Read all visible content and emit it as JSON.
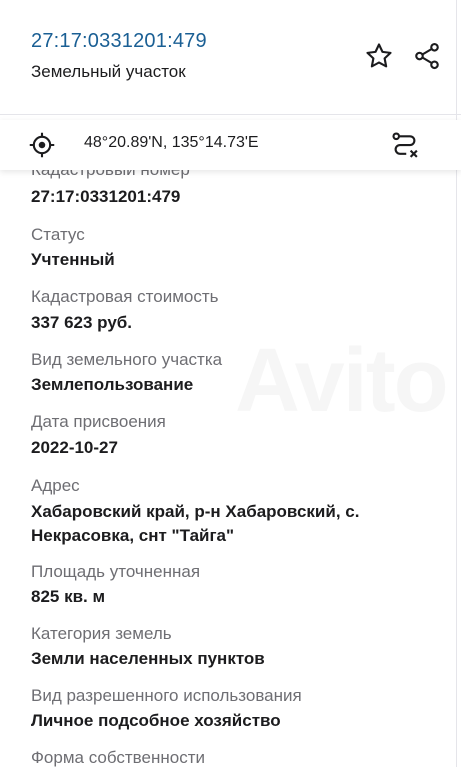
{
  "header": {
    "cadastral_number_link": "27:17:0331201:479",
    "subtitle": "Земельный участок",
    "favorite_icon": "star-outline-icon",
    "share_icon": "share-icon"
  },
  "coords_bar": {
    "location_icon": "crosshair-icon",
    "coordinates": "48°20.89'N, 135°14.73'E",
    "route_icon": "route-icon"
  },
  "fields": [
    {
      "label": "Кадастровый номер",
      "value": "27:17:0331201:479"
    },
    {
      "label": "Статус",
      "value": "Учтенный"
    },
    {
      "label": "Кадастровая стоимость",
      "value": "337 623 руб."
    },
    {
      "label": "Вид земельного участка",
      "value": "Землепользование"
    },
    {
      "label": "Дата присвоения",
      "value": "2022-10-27"
    },
    {
      "label": "Адрес",
      "value": "Хабаровский край, р-н Хабаровский, с. Некрасовка, снт \"Тайга\""
    },
    {
      "label": "Площадь уточненная",
      "value": "825 кв. м"
    },
    {
      "label": "Категория земель",
      "value": "Земли населенных пунктов"
    },
    {
      "label": "Вид разрешенного использования",
      "value": "Личное подсобное хозяйство"
    },
    {
      "label": "Форма собственности",
      "value": ""
    }
  ]
}
